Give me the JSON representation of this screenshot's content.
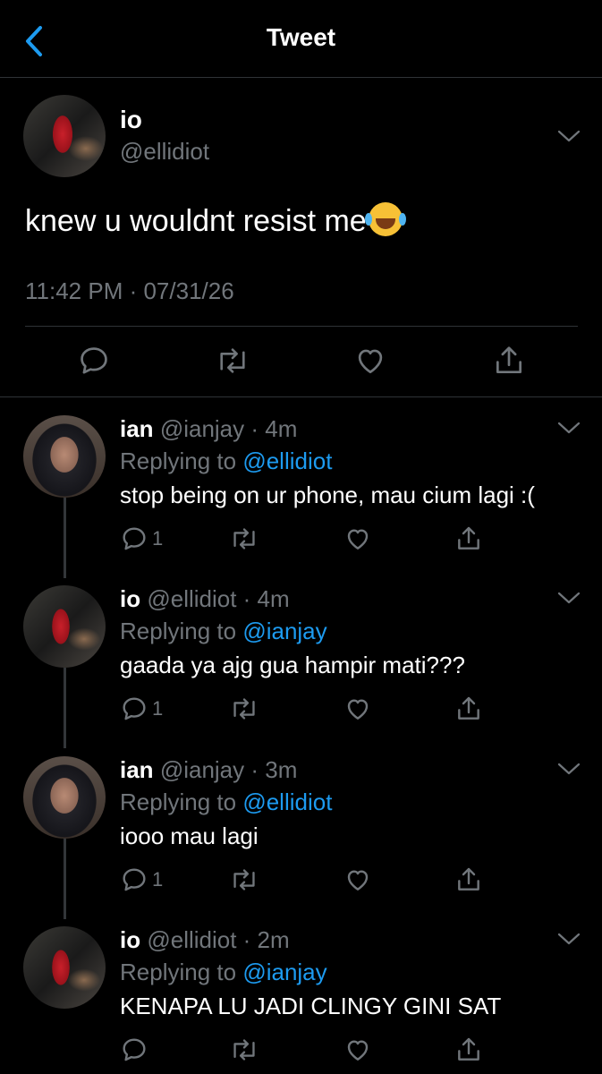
{
  "header": {
    "title": "Tweet",
    "back_icon": "chevron-left-icon"
  },
  "colors": {
    "accent": "#1d9bf0",
    "background": "#000000",
    "muted": "#71767b"
  },
  "main_tweet": {
    "name": "io",
    "handle": "@ellidiot",
    "text": "knew u wouldnt resist me",
    "emoji": "face-with-tears-of-joy",
    "timestamp": "11:42 PM · 07/31/26"
  },
  "replies": [
    {
      "name": "ian",
      "meta": "@ianjay · 4m",
      "replying_prefix": "Replying to ",
      "replying_to": "@ellidiot",
      "text": "stop being on ur phone, mau cium lagi :(",
      "reply_count": "1"
    },
    {
      "name": "io",
      "meta": "@ellidiot · 4m",
      "replying_prefix": "Replying to ",
      "replying_to": "@ianjay",
      "text": "gaada ya ajg gua hampir mati???",
      "reply_count": "1"
    },
    {
      "name": "ian",
      "meta": "@ianjay · 3m",
      "replying_prefix": "Replying to ",
      "replying_to": "@ellidiot",
      "text": "iooo mau lagi",
      "reply_count": "1"
    },
    {
      "name": "io",
      "meta": "@ellidiot · 2m",
      "replying_prefix": "Replying to ",
      "replying_to": "@ianjay",
      "text": "KENAPA LU JADI CLINGY GINI SAT",
      "reply_count": ""
    }
  ]
}
